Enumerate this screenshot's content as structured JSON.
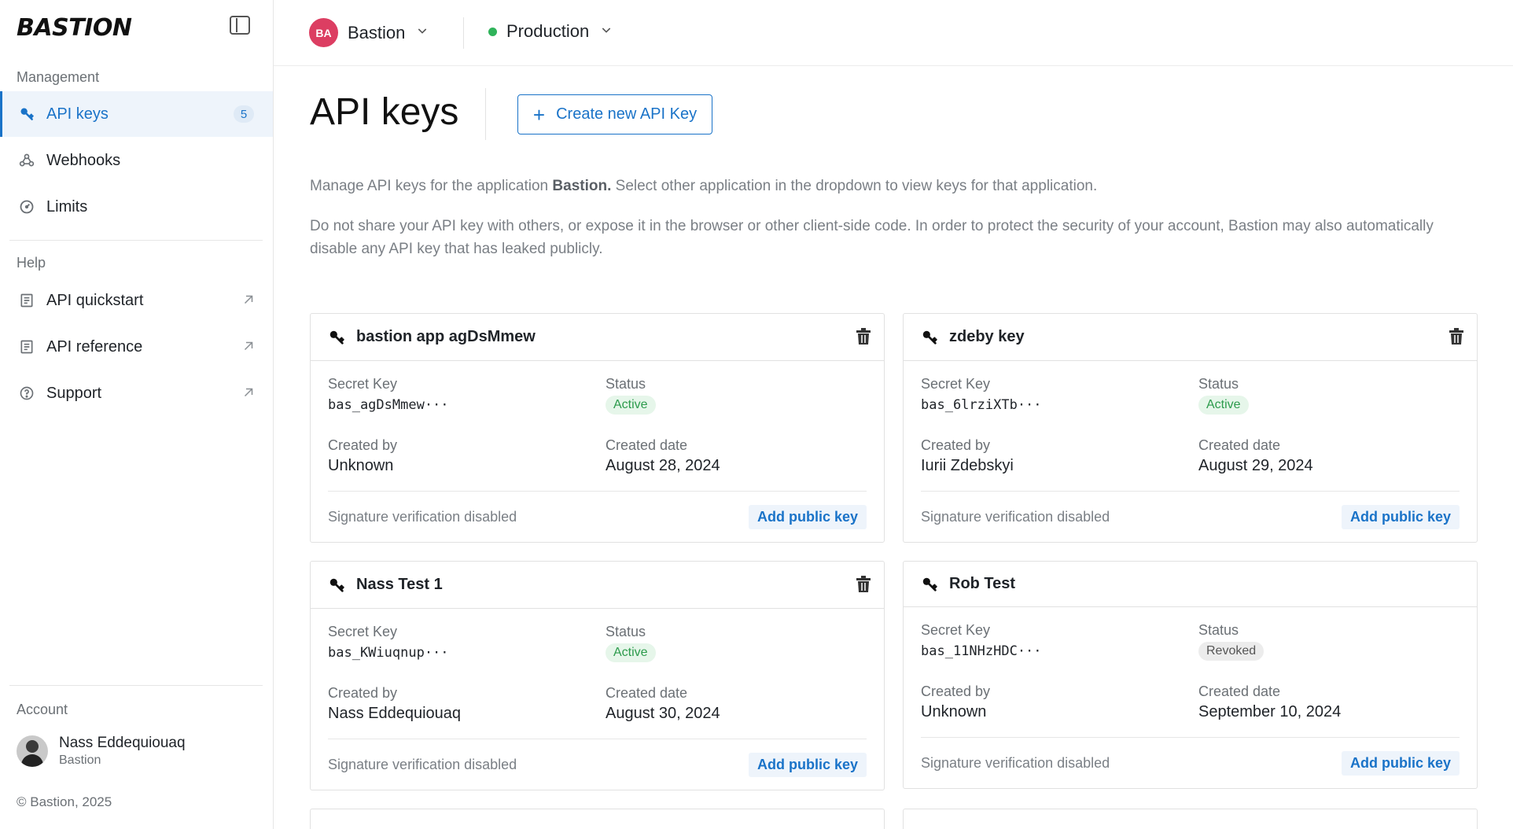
{
  "sidebar": {
    "logo": "BASTION",
    "management_label": "Management",
    "nav": [
      {
        "label": "API keys",
        "badge": "5",
        "icon": "key-icon"
      },
      {
        "label": "Webhooks",
        "icon": "webhook-icon"
      },
      {
        "label": "Limits",
        "icon": "gauge-icon"
      }
    ],
    "help_label": "Help",
    "help": [
      {
        "label": "API quickstart",
        "icon": "book-icon"
      },
      {
        "label": "API reference",
        "icon": "book-icon"
      },
      {
        "label": "Support",
        "icon": "help-circle-icon"
      }
    ],
    "account_label": "Account",
    "account_name": "Nass Eddequiouaq",
    "account_org": "Bastion",
    "copyright": "© Bastion, 2025"
  },
  "topbar": {
    "app_initials": "BA",
    "app_name": "Bastion",
    "env_name": "Production",
    "env_color": "#2fb35a"
  },
  "main": {
    "title": "API keys",
    "create_label": "Create new API Key",
    "desc1_pre": "Manage API keys for the application ",
    "desc1_bold": "Bastion.",
    "desc1_post": " Select other application in the dropdown to view keys for that application.",
    "desc2": "Do not share your API key with others, or expose it in the browser or other client-side code. In order to protect the security of your account, Bastion may also automatically disable any API key that has leaked publicly."
  },
  "labels": {
    "secret_key": "Secret Key",
    "status": "Status",
    "created_by": "Created by",
    "created_date": "Created date",
    "sig_disabled": "Signature verification disabled",
    "add_public_key": "Add public key"
  },
  "cards": [
    {
      "name": "bastion app agDsMmew",
      "secret": "bas_agDsMmew···",
      "status": "Active",
      "created_by": "Unknown",
      "created_date": "August 28, 2024"
    },
    {
      "name": "zdeby key",
      "secret": "bas_6lrziXTb···",
      "status": "Active",
      "created_by": "Iurii Zdebskyi",
      "created_date": "August 29, 2024"
    },
    {
      "name": "Nass Test 1",
      "secret": "bas_KWiuqnup···",
      "status": "Active",
      "created_by": "Nass Eddequiouaq",
      "created_date": "August 30, 2024"
    },
    {
      "name": "Rob Test",
      "secret": "bas_11NHzHDC···",
      "status": "Revoked",
      "created_by": "Unknown",
      "created_date": "September 10, 2024"
    }
  ],
  "colors": {
    "accent": "#1a73c8",
    "active_status": "#2c9b4c",
    "app_avatar": "#dc3e62"
  }
}
